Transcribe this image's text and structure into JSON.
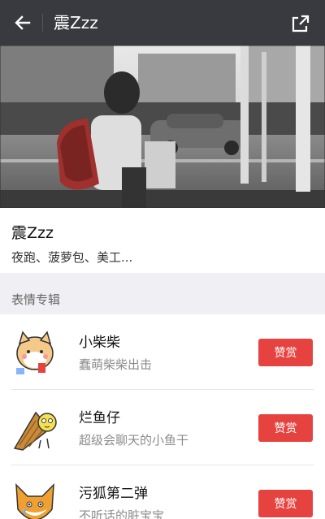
{
  "header": {
    "title": "震Zzz",
    "back_icon": "arrow-left-icon",
    "share_icon": "share-icon",
    "background": "#393a3f"
  },
  "banner": {
    "description_icon": "street-photo-image"
  },
  "artist": {
    "name": "震Zzz",
    "tags": "夜跑、菠萝包、美工..."
  },
  "section": {
    "title": "表情专辑"
  },
  "albums": [
    {
      "name": "小柴柴",
      "desc": "蠢萌柴柴出击",
      "button": "赞赏",
      "icon": "shiba-dog-icon"
    },
    {
      "name": "烂鱼仔",
      "desc": "超级会聊天的小鱼干",
      "button": "赞赏",
      "icon": "dried-fish-icon"
    },
    {
      "name": "污狐第二弹",
      "desc": "不听话的脏宝宝",
      "button": "赞赏",
      "icon": "fox-icon"
    }
  ],
  "colors": {
    "accent_button": "#e64340",
    "section_bg": "#efeff4"
  }
}
